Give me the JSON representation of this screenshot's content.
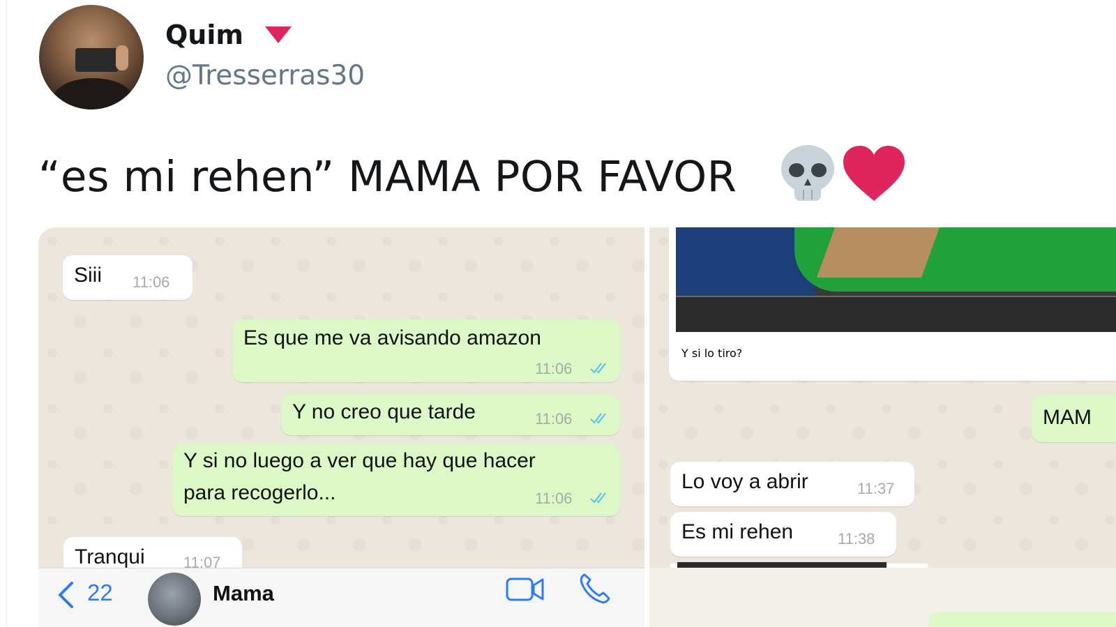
{
  "tweet": {
    "display_name": "Quim",
    "handle": "@Tresserras30",
    "text": "“es mi rehen” MAMA POR FAVOR",
    "emojis": [
      "skull-icon",
      "heart-icon"
    ]
  },
  "chat_left": {
    "messages": [
      {
        "text": "Siii",
        "time": "11:06",
        "direction": "incoming"
      },
      {
        "text": "Es que me va avisando amazon",
        "time": "11:06",
        "direction": "outgoing"
      },
      {
        "text": "Y no creo que tarde",
        "time": "11:06",
        "direction": "outgoing"
      },
      {
        "text_line1": "Y si no luego a ver que hay que hacer",
        "text_line2": "para recogerlo...",
        "time": "11:06",
        "direction": "outgoing"
      },
      {
        "text": "Tranqui",
        "time": "11:07",
        "direction": "incoming"
      }
    ],
    "nav": {
      "back_count": "22",
      "contact_name": "Mama"
    }
  },
  "chat_right": {
    "messages": [
      {
        "text": "Y si lo tiro?",
        "direction": "incoming"
      },
      {
        "text": "MAM",
        "direction": "outgoing"
      },
      {
        "text": "Lo voy a abrir",
        "time": "11:37",
        "direction": "incoming"
      },
      {
        "text": "Es mi rehen",
        "time": "11:38",
        "direction": "incoming"
      }
    ]
  },
  "colors": {
    "incoming_bubble": "#ffffff",
    "outgoing_bubble": "#dcf8c6",
    "chat_background": "#ece6dc",
    "read_ticks": "#4fc3f7",
    "ios_blue": "#2d7cf6",
    "badge": "#e0245e",
    "heart": "#e0245e"
  }
}
